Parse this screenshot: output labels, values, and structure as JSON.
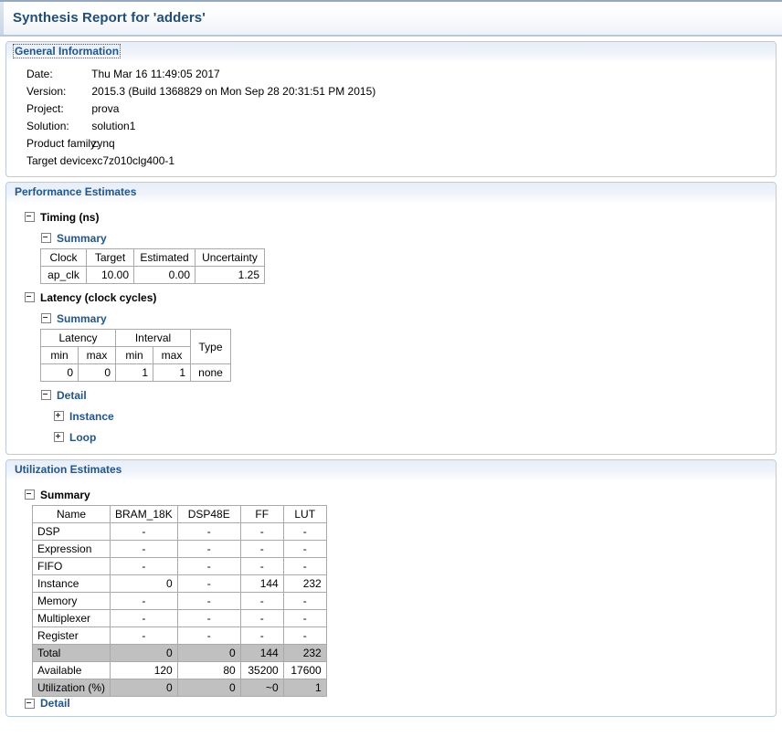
{
  "report": {
    "title": "Synthesis Report for 'adders'"
  },
  "sections": {
    "general": {
      "heading": "General Information",
      "rows": [
        {
          "key": "Date:",
          "value": "Thu Mar 16 11:49:05 2017"
        },
        {
          "key": "Version:",
          "value": "2015.3 (Build 1368829 on Mon Sep 28 20:31:51 PM 2015)"
        },
        {
          "key": "Project:",
          "value": "prova"
        },
        {
          "key": "Solution:",
          "value": "solution1"
        },
        {
          "key": "Product family:",
          "value": "zynq"
        },
        {
          "key": "Target device:",
          "value": "xc7z010clg400-1"
        }
      ]
    },
    "performance": {
      "heading": "Performance Estimates",
      "timing": {
        "label": "Timing (ns)",
        "summary_label": "Summary",
        "columns": [
          "Clock",
          "Target",
          "Estimated",
          "Uncertainty"
        ],
        "rows": [
          {
            "clock": "ap_clk",
            "target": "10.00",
            "estimated": "0.00",
            "uncertainty": "1.25"
          }
        ]
      },
      "latency": {
        "label": "Latency (clock cycles)",
        "summary_label": "Summary",
        "group_headers": [
          "Latency",
          "Interval",
          ""
        ],
        "sub_headers": [
          "min",
          "max",
          "min",
          "max"
        ],
        "type_header": "Type",
        "rows": [
          {
            "latency_min": "0",
            "latency_max": "0",
            "interval_min": "1",
            "interval_max": "1",
            "type": "none"
          }
        ],
        "detail_label": "Detail",
        "detail_items": [
          {
            "label": "Instance",
            "expanded": false
          },
          {
            "label": "Loop",
            "expanded": false
          }
        ]
      }
    },
    "utilization": {
      "heading": "Utilization Estimates",
      "summary_label": "Summary",
      "columns": [
        "Name",
        "BRAM_18K",
        "DSP48E",
        "FF",
        "LUT"
      ],
      "rows": [
        {
          "name": "DSP",
          "bram": "-",
          "dsp": "-",
          "ff": "-",
          "lut": "-",
          "highlight": false
        },
        {
          "name": "Expression",
          "bram": "-",
          "dsp": "-",
          "ff": "-",
          "lut": "-",
          "highlight": false
        },
        {
          "name": "FIFO",
          "bram": "-",
          "dsp": "-",
          "ff": "-",
          "lut": "-",
          "highlight": false
        },
        {
          "name": "Instance",
          "bram": "0",
          "dsp": "-",
          "ff": "144",
          "lut": "232",
          "highlight": false
        },
        {
          "name": "Memory",
          "bram": "-",
          "dsp": "-",
          "ff": "-",
          "lut": "-",
          "highlight": false
        },
        {
          "name": "Multiplexer",
          "bram": "-",
          "dsp": "-",
          "ff": "-",
          "lut": "-",
          "highlight": false
        },
        {
          "name": "Register",
          "bram": "-",
          "dsp": "-",
          "ff": "-",
          "lut": "-",
          "highlight": false
        },
        {
          "name": "Total",
          "bram": "0",
          "dsp": "0",
          "ff": "144",
          "lut": "232",
          "highlight": true
        },
        {
          "name": "Available",
          "bram": "120",
          "dsp": "80",
          "ff": "35200",
          "lut": "17600",
          "highlight": false
        },
        {
          "name": "Utilization (%)",
          "bram": "0",
          "dsp": "0",
          "ff": "~0",
          "lut": "1",
          "highlight": true
        }
      ],
      "detail_label": "Detail"
    }
  },
  "colors": {
    "title": "#1f4e79",
    "section_heading": "#1f5592",
    "panel_border": "#b9cbe0",
    "table_border": "#a9a9a9",
    "highlight_row": "#c0c0c0"
  }
}
